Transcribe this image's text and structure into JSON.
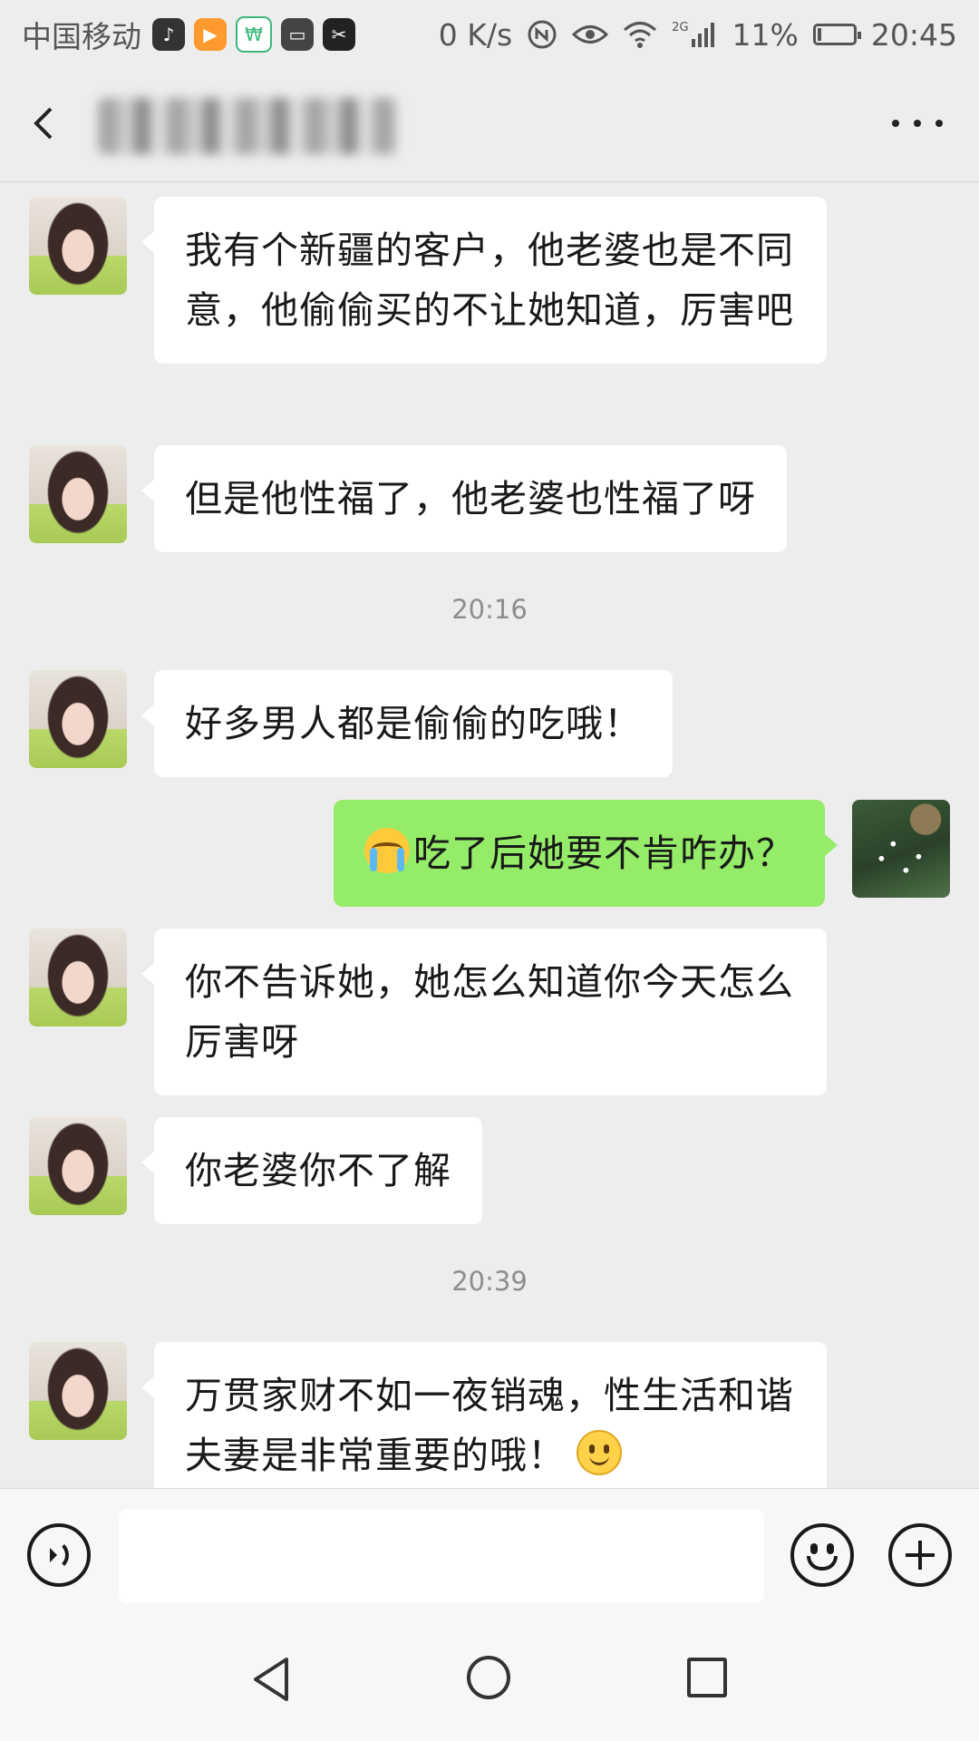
{
  "status_bar": {
    "carrier": "中国移动",
    "app_icons": [
      {
        "name": "tiktok-icon",
        "color": "#333333"
      },
      {
        "name": "video-app-icon",
        "color": "#ff9a2e"
      },
      {
        "name": "bank-app-icon",
        "color": "#3ab87a"
      },
      {
        "name": "wallet-app-icon",
        "color": "#444444"
      },
      {
        "name": "capcut-icon",
        "color": "#222222"
      }
    ],
    "net_speed": "0 K/s",
    "network_type": "2G",
    "battery": "11%",
    "battery_level": 0.11,
    "time": "20:45"
  },
  "nav": {
    "title": "██████"
  },
  "messages": [
    {
      "id": "m1",
      "side": "in",
      "text": "我有个新疆的客户，他老婆也是不同意，他偷偷买的不让她知道，厉害吧"
    },
    {
      "id": "m2",
      "side": "in",
      "text": "但是他性福了，他老婆也性福了呀"
    },
    {
      "id": "t1",
      "type": "time",
      "text": "20:16"
    },
    {
      "id": "m3",
      "side": "in",
      "text": "好多男人都是偷偷的吃哦！"
    },
    {
      "id": "m4",
      "side": "out",
      "emoji": "crying-emoji",
      "text": "吃了后她要不肯咋办？"
    },
    {
      "id": "m5",
      "side": "in",
      "text": "你不告诉她，她怎么知道你今天怎么厉害呀"
    },
    {
      "id": "m6",
      "side": "in",
      "text": "你老婆你不了解"
    },
    {
      "id": "t2",
      "type": "time",
      "text": "20:39"
    },
    {
      "id": "m7",
      "side": "in",
      "text": "万贯家财不如一夜销魂，性生活和谐夫妻是非常重要的哦！",
      "emoji_after": "smile-emoji"
    }
  ],
  "input": {
    "value": "",
    "placeholder": ""
  },
  "colors": {
    "background": "#ededed",
    "incoming_bubble": "#ffffff",
    "outgoing_bubble": "#95ec69",
    "timestamp": "#8d8d8d"
  }
}
